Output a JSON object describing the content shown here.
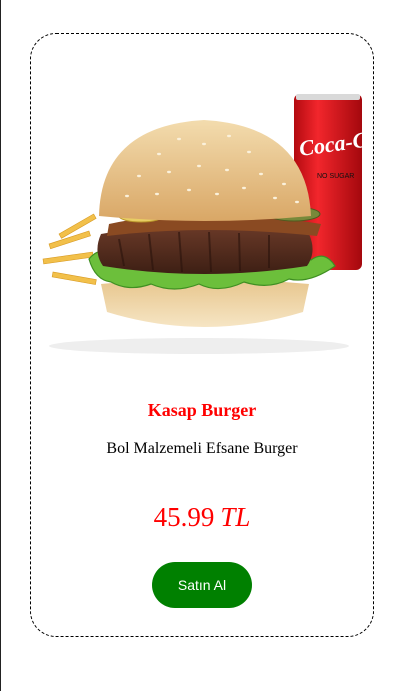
{
  "product": {
    "title": "Kasap Burger",
    "description": "Bol Malzemeli Efsane Burger",
    "price": "45.99",
    "currency": "TL",
    "buy_label": "Satın Al",
    "can_label": "Coca-Cola",
    "can_sub_label": "NO SUGAR"
  },
  "colors": {
    "title": "#ff0000",
    "price": "#ff0000",
    "button": "#008000",
    "can": "#e8141b"
  }
}
